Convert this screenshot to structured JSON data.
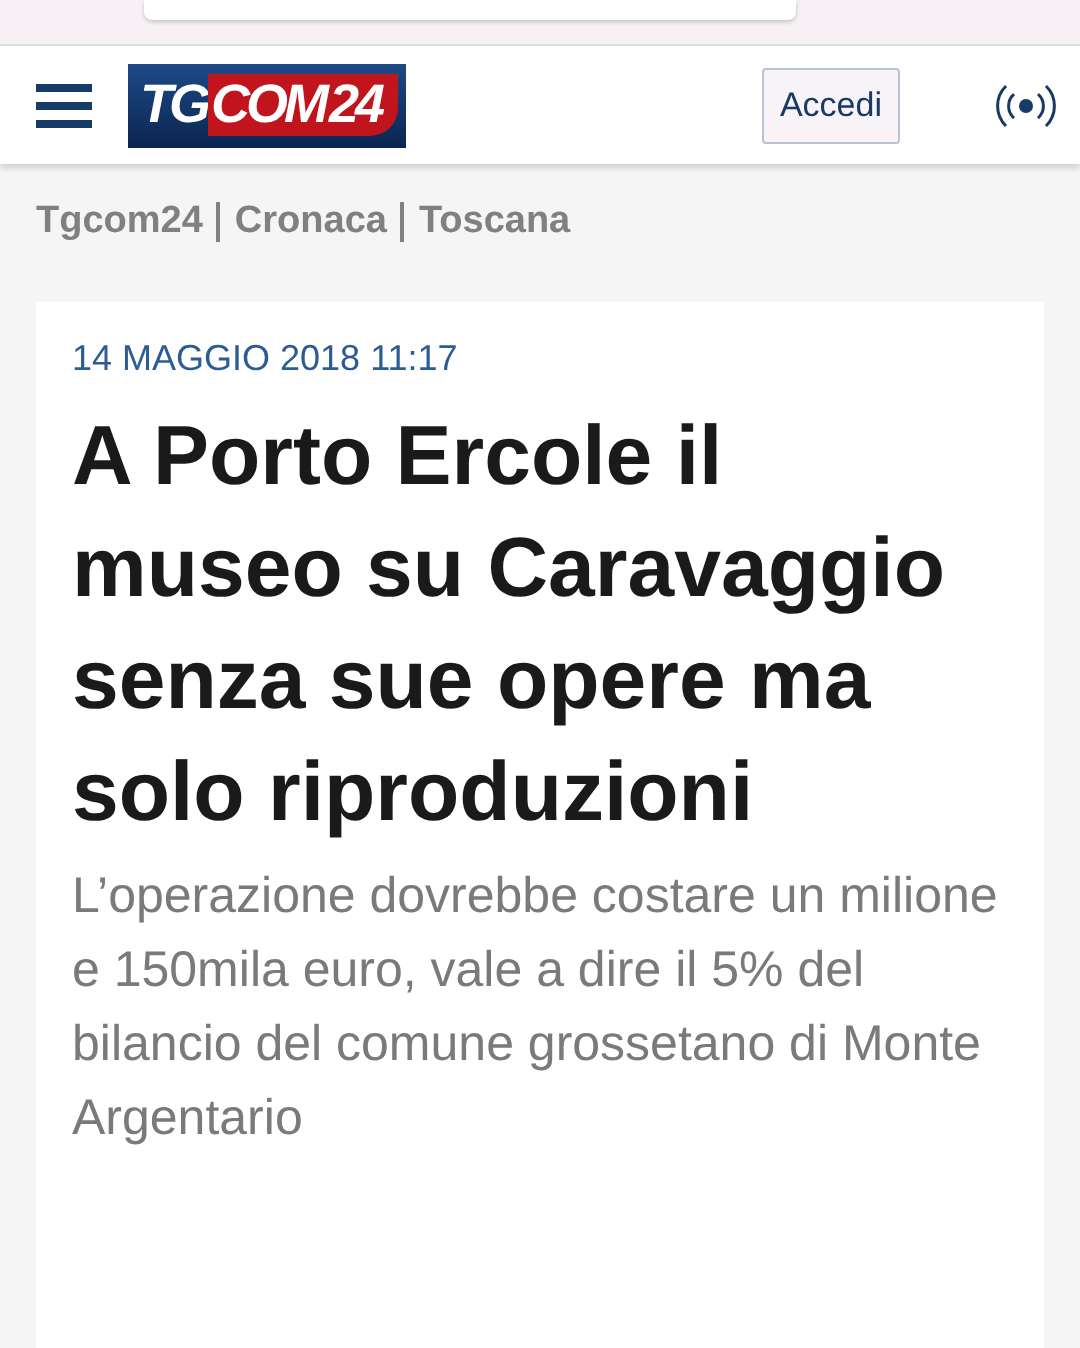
{
  "header": {
    "logo": {
      "part_1": "TG",
      "part_2": "COM",
      "part_3": "24"
    },
    "login_button": "Accedi"
  },
  "breadcrumb": [
    "Tgcom24",
    "Cronaca",
    "Toscana"
  ],
  "article": {
    "date": "14 MAGGIO 2018 11:17",
    "title": "A Porto Ercole il museo su Caravaggio senza sue opere ma solo riproduzioni",
    "subtitle": "L’operazione dovrebbe costare un milione e 150mila euro, vale a dire il 5% del bilancio del comune grossetano di Monte Argentario"
  }
}
